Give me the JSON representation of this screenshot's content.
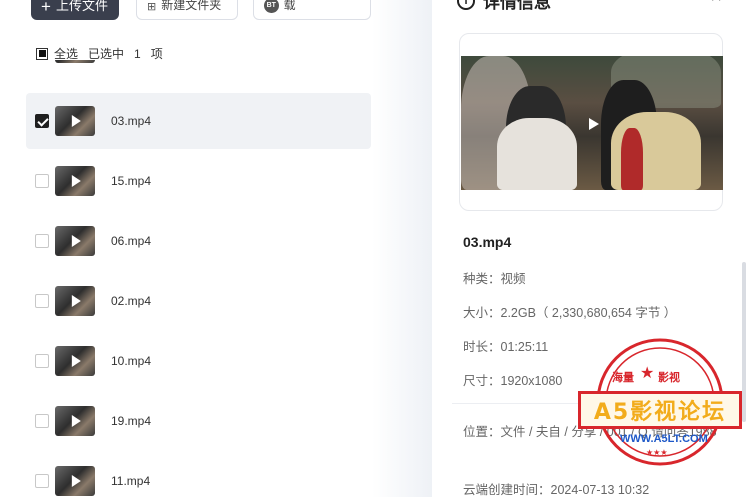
{
  "toolbar": {
    "upload_label": "上传文件",
    "new_folder_label": "新建文件夹",
    "bt_badge": "BT",
    "bt_label": "BT/磁力链下载"
  },
  "selection": {
    "select_all_label": "全选",
    "selected_text": "已选中",
    "selected_count": "1",
    "selected_unit": "项"
  },
  "files": [
    {
      "name": "03.mp4",
      "checked": true
    },
    {
      "name": "15.mp4",
      "checked": false
    },
    {
      "name": "06.mp4",
      "checked": false
    },
    {
      "name": "02.mp4",
      "checked": false
    },
    {
      "name": "10.mp4",
      "checked": false
    },
    {
      "name": "19.mp4",
      "checked": false
    },
    {
      "name": "11.mp4",
      "checked": false
    }
  ],
  "details": {
    "title": "详情信息",
    "info_icon_glyph": "i",
    "close_glyph": "×",
    "name": "03.mp4",
    "type_line": "种类：视频",
    "size_line": "大小：2.2GB（ 2,330,680,654 字节 ）",
    "duration_line": "时长：01:25:11",
    "resolution_line": "尺寸：1920x1080",
    "location_line": "位置：文件 / 夫自 / 分享 / 001 / Q 请问答1988",
    "created_line": "云端创建时间：2024-07-13 10:32"
  },
  "watermark": {
    "top_left": "海量",
    "top_right": "影视",
    "star": "★",
    "main": "A5影视论坛",
    "url": "WWW.A5LT.COM",
    "bottom_stars": "★★★"
  },
  "colors": {
    "upload_bg": "#3a3f4d",
    "selected_row_bg": "#f0f2f5",
    "seal_red": "#d8262c",
    "seal_gold": "#f2ac1c",
    "seal_blue": "#1e58c8"
  }
}
